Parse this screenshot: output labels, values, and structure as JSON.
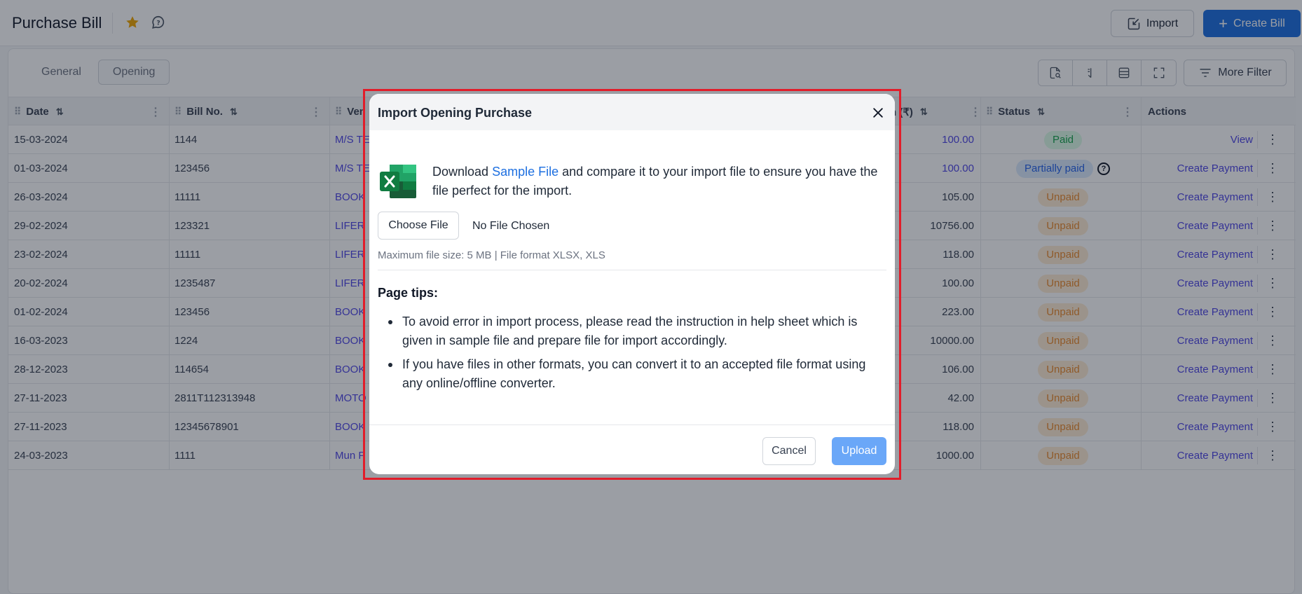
{
  "header": {
    "title": "Purchase Bill",
    "import_label": "Import",
    "create_label": "Create Bill"
  },
  "tabs": [
    {
      "label": "General",
      "active": false
    },
    {
      "label": "Opening",
      "active": true
    }
  ],
  "toolbar": {
    "more_filter_label": "More Filter"
  },
  "table": {
    "columns": [
      "Date",
      "Bill No.",
      "Ven",
      "n (₹)",
      "Status",
      "Actions"
    ],
    "rows": [
      {
        "date": "15-03-2024",
        "bill": "1144",
        "vendor": "M/S TE",
        "amount": "100.00",
        "amount_blue": true,
        "status": "Paid",
        "status_type": "paid",
        "action": "View"
      },
      {
        "date": "01-03-2024",
        "bill": "123456",
        "vendor": "M/S TE",
        "amount": "100.00",
        "amount_blue": true,
        "status": "Partially paid",
        "status_type": "partial",
        "action": "Create Payment"
      },
      {
        "date": "26-03-2024",
        "bill": "11111",
        "vendor": "BOOK",
        "amount": "105.00",
        "amount_blue": false,
        "status": "Unpaid",
        "status_type": "unpaid",
        "action": "Create Payment"
      },
      {
        "date": "29-02-2024",
        "bill": "123321",
        "vendor": "LIFER",
        "amount": "10756.00",
        "amount_blue": false,
        "status": "Unpaid",
        "status_type": "unpaid",
        "action": "Create Payment"
      },
      {
        "date": "23-02-2024",
        "bill": "11111",
        "vendor": "LIFER",
        "amount": "118.00",
        "amount_blue": false,
        "status": "Unpaid",
        "status_type": "unpaid",
        "action": "Create Payment"
      },
      {
        "date": "20-02-2024",
        "bill": "1235487",
        "vendor": "LIFER",
        "amount": "100.00",
        "amount_blue": false,
        "status": "Unpaid",
        "status_type": "unpaid",
        "action": "Create Payment"
      },
      {
        "date": "01-02-2024",
        "bill": "123456",
        "vendor": "BOOK",
        "amount": "223.00",
        "amount_blue": false,
        "status": "Unpaid",
        "status_type": "unpaid",
        "action": "Create Payment"
      },
      {
        "date": "16-03-2023",
        "bill": "1224",
        "vendor": "BOOK",
        "amount": "10000.00",
        "amount_blue": false,
        "status": "Unpaid",
        "status_type": "unpaid",
        "action": "Create Payment"
      },
      {
        "date": "28-12-2023",
        "bill": "114654",
        "vendor": "BOOK",
        "amount": "106.00",
        "amount_blue": false,
        "status": "Unpaid",
        "status_type": "unpaid",
        "action": "Create Payment"
      },
      {
        "date": "27-11-2023",
        "bill": "2811T112313948",
        "vendor": "MOTO",
        "amount": "42.00",
        "amount_blue": false,
        "status": "Unpaid",
        "status_type": "unpaid",
        "action": "Create Payment"
      },
      {
        "date": "27-11-2023",
        "bill": "12345678901",
        "vendor": "BOOK",
        "amount": "118.00",
        "amount_blue": false,
        "status": "Unpaid",
        "status_type": "unpaid",
        "action": "Create Payment"
      },
      {
        "date": "24-03-2023",
        "bill": "1111",
        "vendor": "Mun P",
        "amount": "1000.00",
        "amount_blue": false,
        "status": "Unpaid",
        "status_type": "unpaid",
        "action": "Create Payment"
      }
    ]
  },
  "modal": {
    "title": "Import Opening Purchase",
    "download_prefix": "Download ",
    "sample_link": "Sample File",
    "download_suffix": " and compare it to your import file to ensure you have the file perfect for the import.",
    "choose_file_label": "Choose File",
    "no_file_label": "No File Chosen",
    "max_size_text": "Maximum file size: 5 MB | File format XLSX, XLS",
    "tips_title": "Page tips:",
    "tips": [
      "To avoid error in import process, please read the instruction in help sheet which is given in sample file and prepare file for import accordingly.",
      "If you have files in other formats, you can convert it to an accepted file format using any online/offline converter."
    ],
    "cancel_label": "Cancel",
    "upload_label": "Upload"
  },
  "colors": {
    "primary": "#1d6fe0",
    "link": "#4f46e5",
    "highlight": "#e11d2a",
    "star": "#f0a500"
  }
}
